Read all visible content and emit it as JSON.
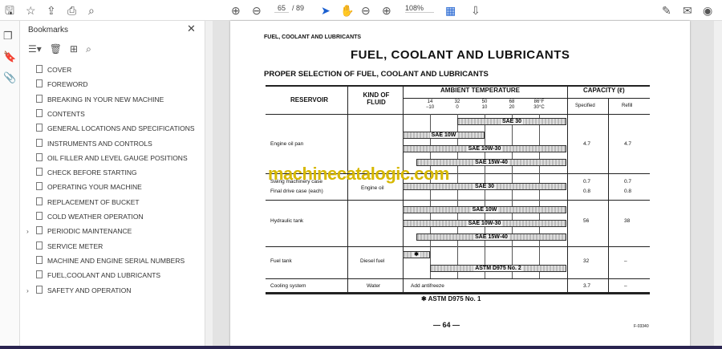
{
  "toolbar": {
    "page_current": "65",
    "page_total": "/ 89",
    "zoom": "108%"
  },
  "bookmarks": {
    "title": "Bookmarks",
    "items": [
      {
        "label": "COVER",
        "expandable": false
      },
      {
        "label": "FOREWORD",
        "expandable": false
      },
      {
        "label": "BREAKING IN YOUR NEW MACHINE",
        "expandable": false
      },
      {
        "label": "CONTENTS",
        "expandable": false
      },
      {
        "label": "GENERAL LOCATIONS AND SPECIFICATIONS",
        "expandable": false
      },
      {
        "label": "INSTRUMENTS AND CONTROLS",
        "expandable": false
      },
      {
        "label": "OIL FILLER AND LEVEL GAUGE POSITIONS",
        "expandable": false
      },
      {
        "label": "CHECK BEFORE STARTING",
        "expandable": false
      },
      {
        "label": "OPERATING YOUR MACHINE",
        "expandable": false
      },
      {
        "label": "REPLACEMENT OF BUCKET",
        "expandable": false
      },
      {
        "label": "COLD WEATHER OPERATION",
        "expandable": false
      },
      {
        "label": "PERIODIC MAINTENANCE",
        "expandable": true
      },
      {
        "label": "SERVICE METER",
        "expandable": false
      },
      {
        "label": "MACHINE AND ENGINE SERIAL NUMBERS",
        "expandable": false
      },
      {
        "label": "FUEL,COOLANT AND LUBRICANTS",
        "expandable": false
      },
      {
        "label": "SAFETY AND OPERATION",
        "expandable": true
      }
    ]
  },
  "page": {
    "header": "FUEL, COOLANT AND LUBRICANTS",
    "title": "FUEL, COOLANT AND LUBRICANTS",
    "subtitle": "PROPER SELECTION OF FUEL, COOLANT AND LUBRICANTS",
    "watermark": "machinecatalogic.com",
    "page_number": "— 64 —",
    "code": "F-03340",
    "footnote": "✱ ASTM D975 No. 1"
  },
  "table": {
    "headers": {
      "reservoir": "RESERVOIR",
      "fluid": "KIND OF FLUID",
      "temp": "AMBIENT TEMPERATURE",
      "capacity": "CAPACITY (ℓ)",
      "specified": "Specified",
      "refill": "Refill"
    },
    "temp_ticks": [
      {
        "f": "14",
        "c": "−10"
      },
      {
        "f": "32",
        "c": "0"
      },
      {
        "f": "50",
        "c": "10"
      },
      {
        "f": "68",
        "c": "20"
      },
      {
        "f": "86°F",
        "c": "30°C"
      }
    ],
    "rows": [
      {
        "reservoir": "Engine oil pan",
        "fluid": "",
        "specified": "4.7",
        "refill": "4.7"
      },
      {
        "reservoir": "Swing machinery case",
        "reservoir2": "Final drive case (each)",
        "fluid": "Engine oil",
        "specified": "0.7",
        "specified2": "0.8",
        "refill": "0.7",
        "refill2": "0.8"
      },
      {
        "reservoir": "Hydraulic tank",
        "fluid": "",
        "specified": "56",
        "refill": "38"
      },
      {
        "reservoir": "Fuel tank",
        "fluid": "Diesel fuel",
        "specified": "32",
        "refill": "–"
      },
      {
        "reservoir": "Cooling system",
        "fluid": "Water",
        "temp_note": "Add antifreeze",
        "specified": "3.7",
        "refill": "–"
      }
    ],
    "bars": [
      {
        "label": "SAE 30",
        "from_c": 0,
        "to_c": 40
      },
      {
        "label": "SAE 10W",
        "from_c": -20,
        "to_c": 10
      },
      {
        "label": "SAE 10W-30",
        "from_c": -20,
        "to_c": 40
      },
      {
        "label": "SAE 15W-40",
        "from_c": -15,
        "to_c": 40
      },
      {
        "label": "SAE 30",
        "from_c": -20,
        "to_c": 40
      },
      {
        "label": "SAE 10W",
        "from_c": -20,
        "to_c": 40
      },
      {
        "label": "SAE 10W-30",
        "from_c": -20,
        "to_c": 40
      },
      {
        "label": "SAE 15W-40",
        "from_c": -15,
        "to_c": 40
      },
      {
        "label": "✱",
        "from_c": -20,
        "to_c": -10
      },
      {
        "label": "ASTM D975 No. 2",
        "from_c": -10,
        "to_c": 40
      }
    ]
  }
}
